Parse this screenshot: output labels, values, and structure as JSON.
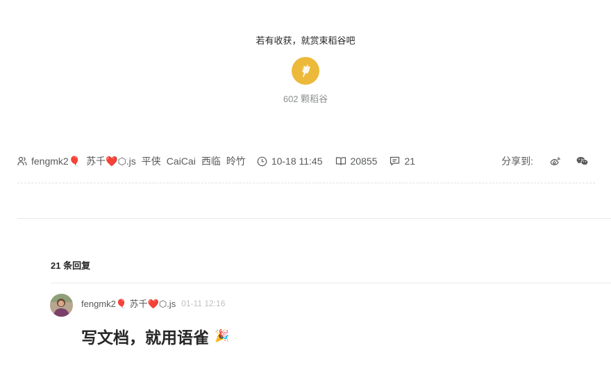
{
  "reward": {
    "title": "若有收获，就赏束稻谷吧",
    "count": "602 颗稻谷"
  },
  "meta": {
    "contributors": [
      "fengmk2🎈",
      "苏千❤️⬡.js",
      "平侠",
      "CaiCai",
      "西临",
      "昤竹"
    ],
    "updated_time": "10-18 11:45",
    "read_count": "20855",
    "comment_count": "21",
    "share_label": "分享到:"
  },
  "replies": {
    "title": "21 条回复"
  },
  "comment": {
    "author": "fengmk2🎈 苏千❤️⬡.js",
    "time": "01-11 12:16",
    "text": "写文档，就用语雀",
    "emoji": "🎉"
  },
  "colors": {
    "reward_gold": "#ECB93A",
    "text_secondary": "#585a5a",
    "time_gray": "#bec0bf"
  }
}
